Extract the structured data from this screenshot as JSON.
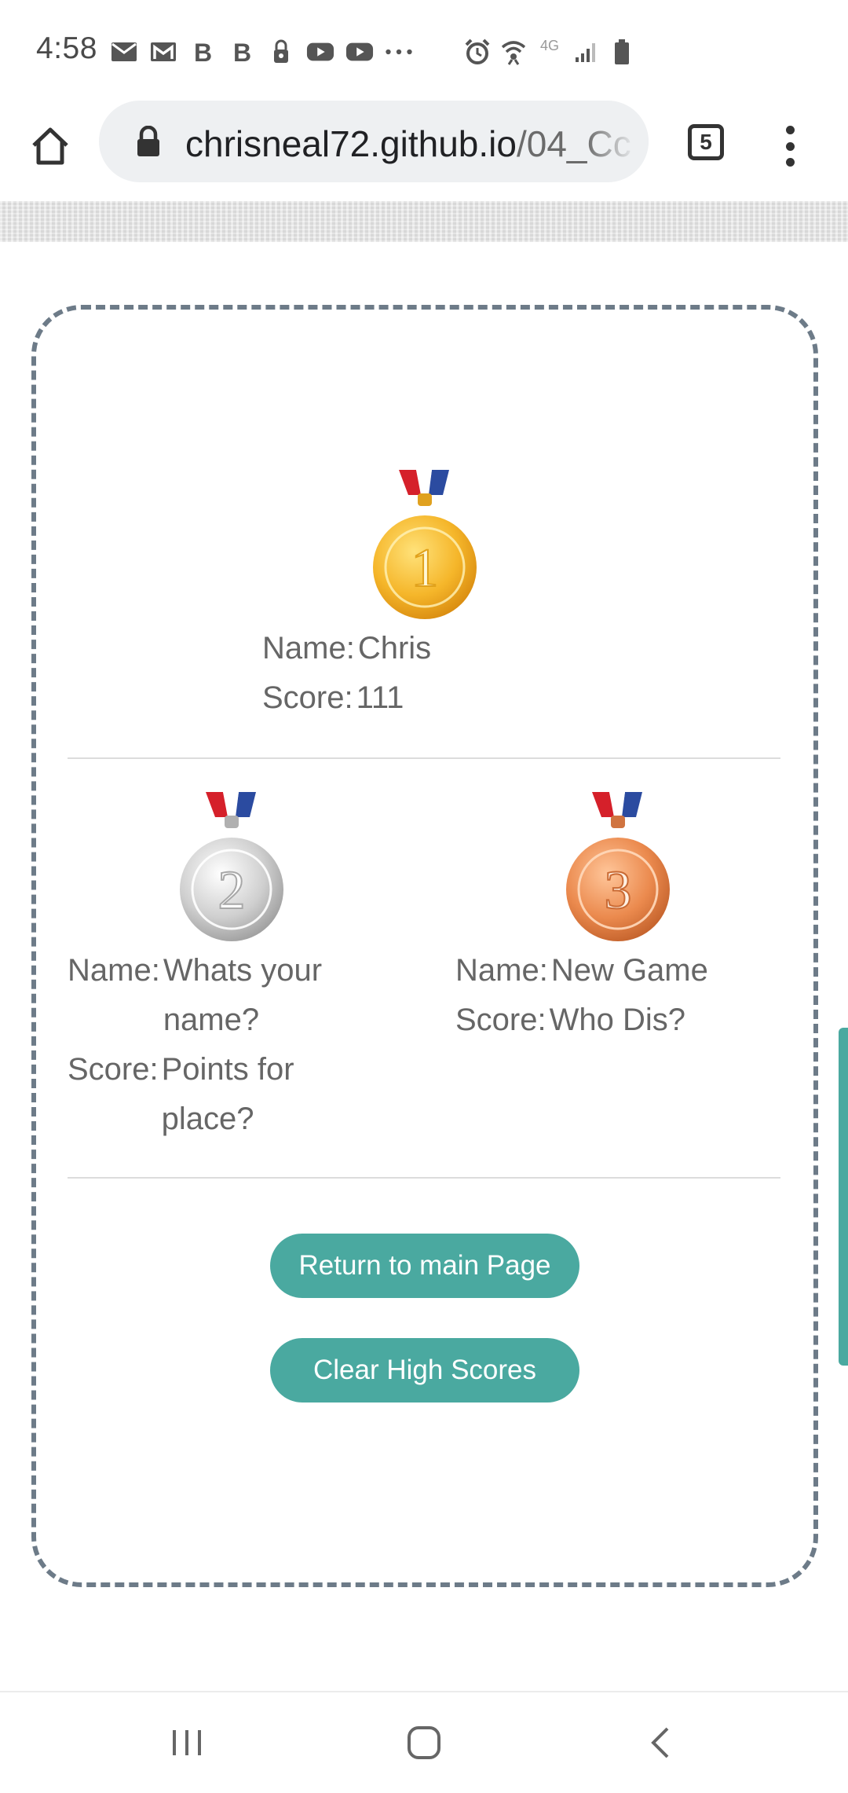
{
  "status_bar": {
    "time": "4:58",
    "network": "4G"
  },
  "browser": {
    "url_domain": "chrisneal72.github.io",
    "url_path": "/04_Cc",
    "tab_count": "5"
  },
  "scores": {
    "first": {
      "medal_number": "1",
      "name_label": "Name:",
      "name": "Chris",
      "score_label": "Score:",
      "score": "111"
    },
    "second": {
      "medal_number": "2",
      "name_label": "Name:",
      "name": "Whats your name?",
      "score_label": "Score:",
      "score": "Points for place?"
    },
    "third": {
      "medal_number": "3",
      "name_label": "Name:",
      "name": "New Game",
      "score_label": "Score:",
      "score": "Who Dis?"
    }
  },
  "buttons": {
    "return_label": "Return to main Page",
    "clear_label": "Clear High Scores"
  },
  "colors": {
    "button_bg": "#4aa9a0",
    "card_border": "#6d7b88",
    "gold": "#f2b52a",
    "silver": "#c9c9c9",
    "bronze": "#e3834a"
  },
  "icons": {
    "home": "home-icon",
    "lock": "lock-icon",
    "menu": "more-vert-icon",
    "nav_recents": "recents-icon",
    "nav_home": "home-circle-icon",
    "nav_back": "back-icon"
  }
}
